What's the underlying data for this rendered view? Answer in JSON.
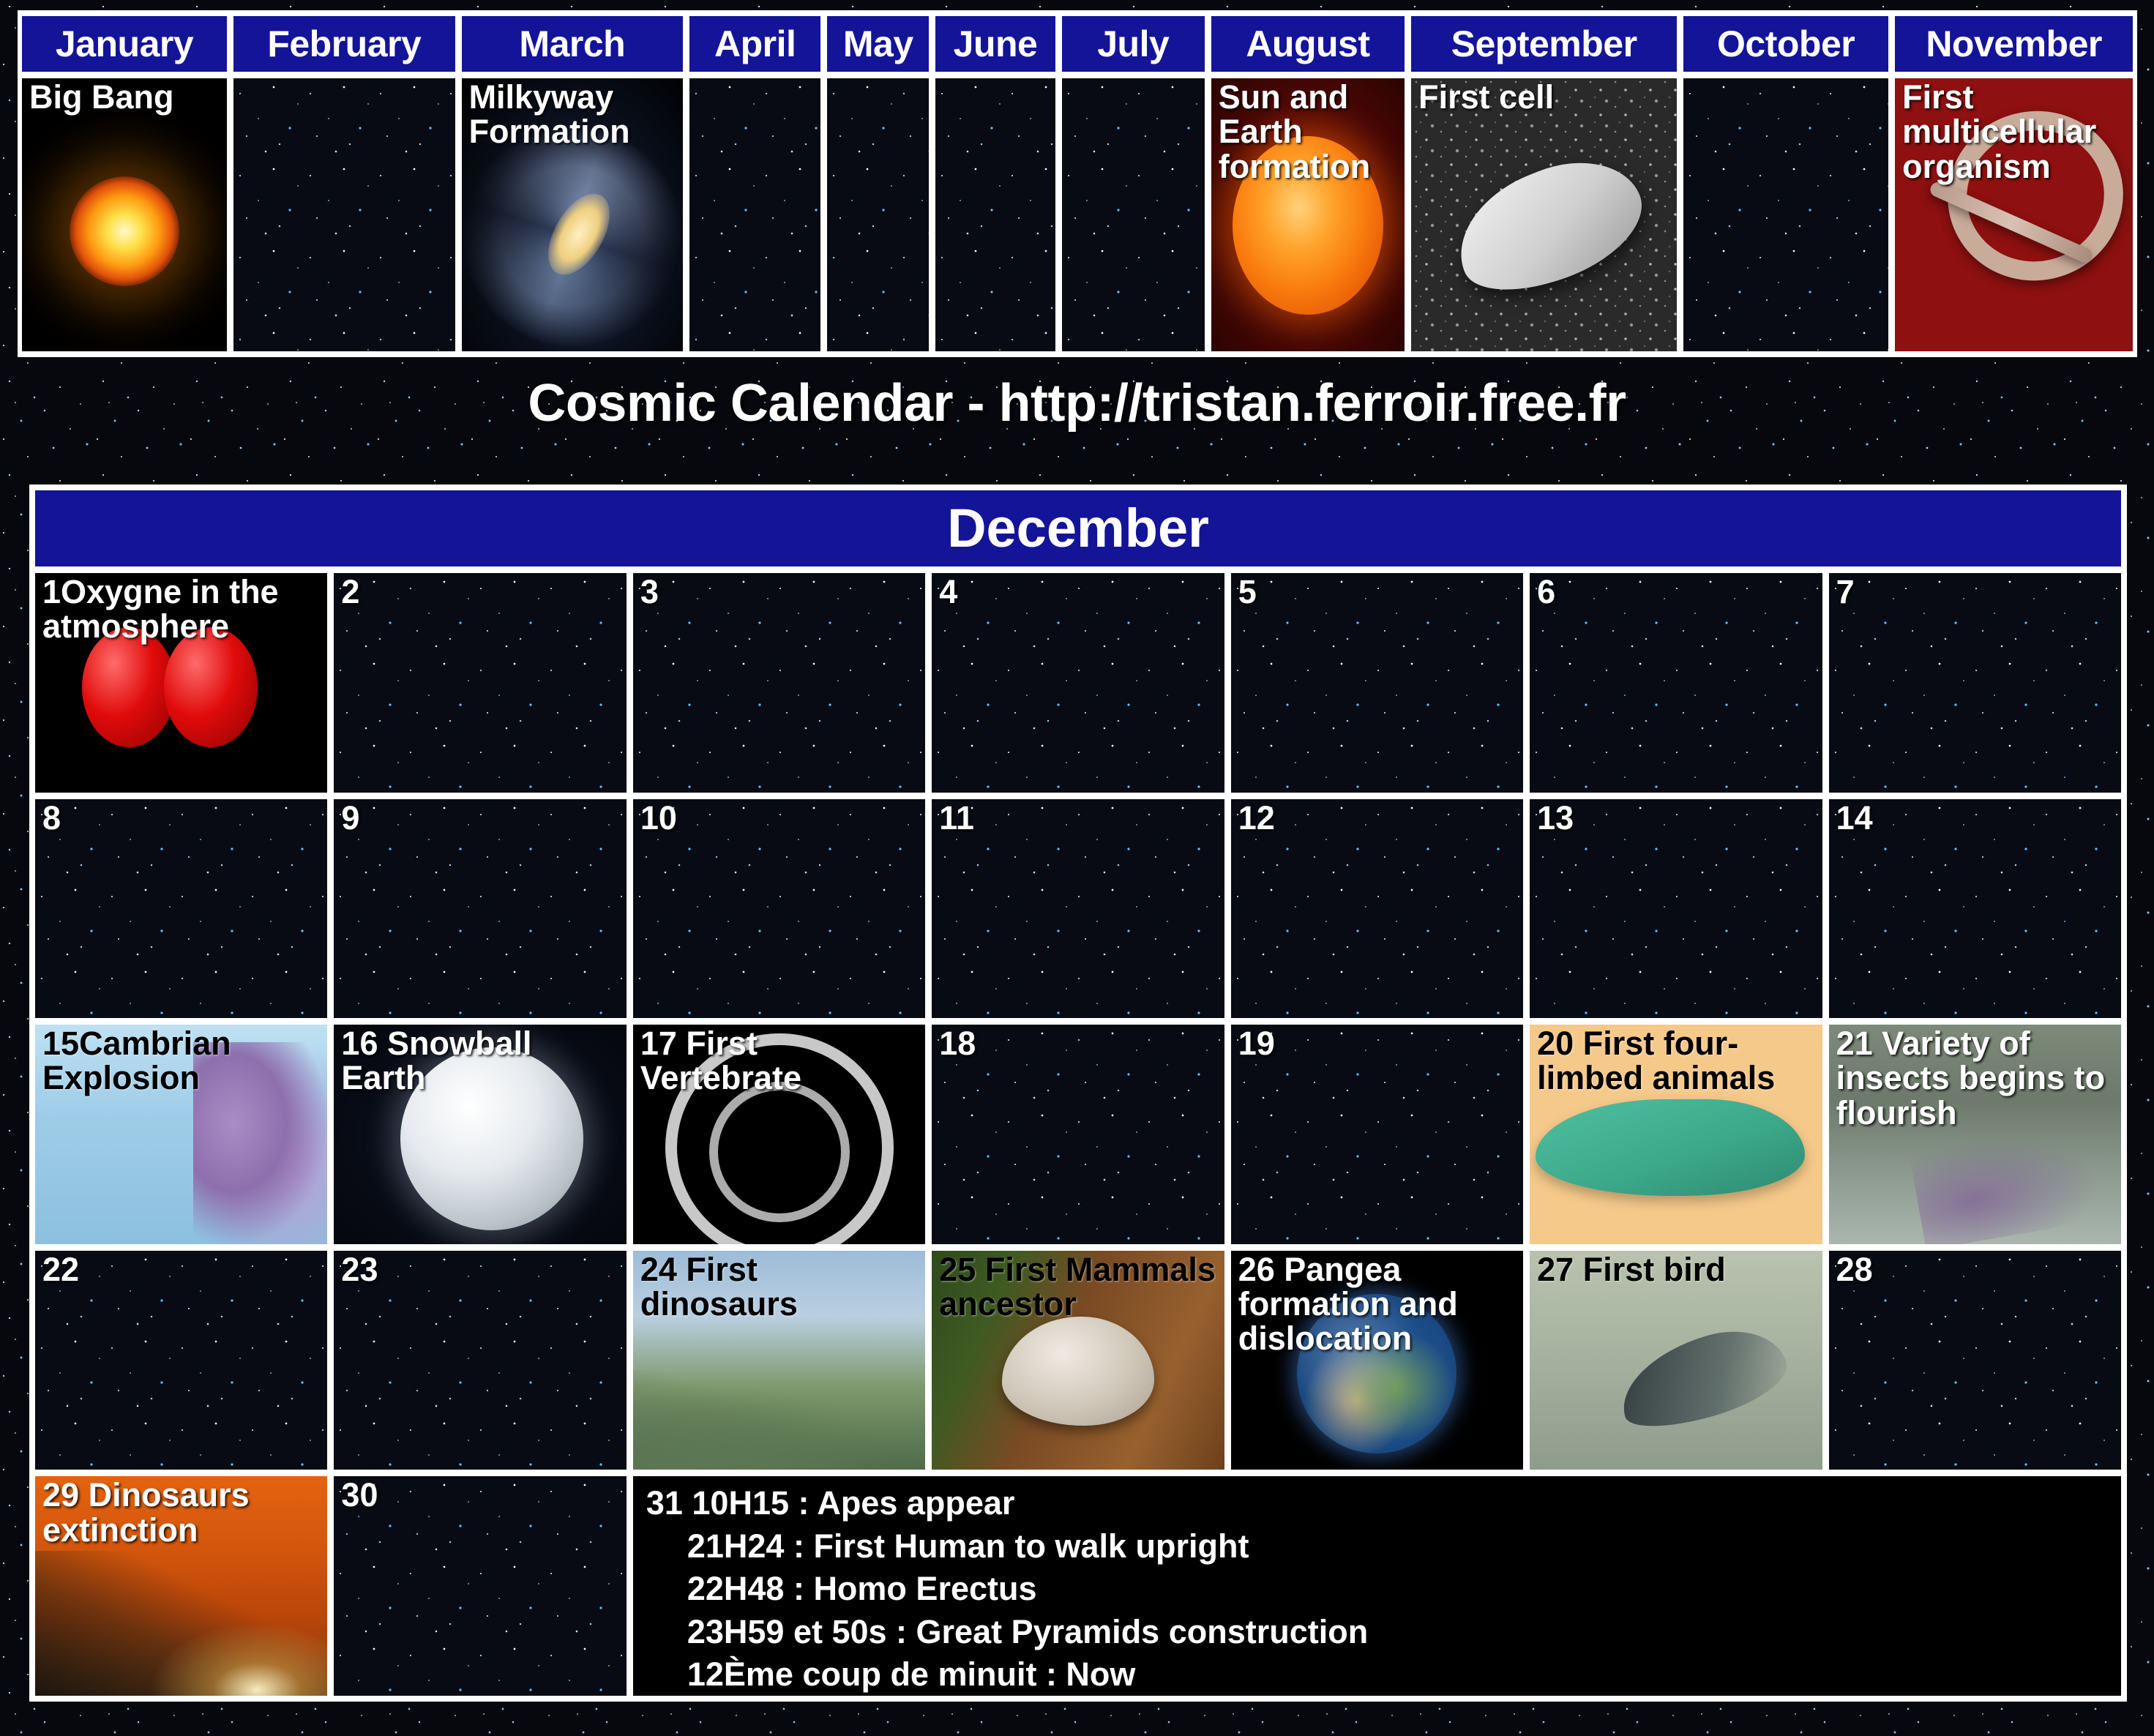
{
  "title": "Cosmic Calendar - http://tristan.ferroir.free.fr",
  "colors": {
    "header_blue": "#141499",
    "panel_white": "#ffffff",
    "caption_white": "#ffffff",
    "caption_black": "#000000"
  },
  "months": [
    {
      "name": "January",
      "caption": "Big Bang",
      "caption_color": "white",
      "art": "bigbang"
    },
    {
      "name": "February",
      "caption": "",
      "caption_color": "white",
      "art": "stars"
    },
    {
      "name": "March",
      "caption": "Milkyway Formation",
      "caption_color": "white",
      "art": "milkyway"
    },
    {
      "name": "April",
      "caption": "",
      "caption_color": "white",
      "art": "stars"
    },
    {
      "name": "May",
      "caption": "",
      "caption_color": "white",
      "art": "stars"
    },
    {
      "name": "June",
      "caption": "",
      "caption_color": "white",
      "art": "stars"
    },
    {
      "name": "July",
      "caption": "",
      "caption_color": "white",
      "art": "stars"
    },
    {
      "name": "August",
      "caption": "Sun and Earth formation",
      "caption_color": "white",
      "art": "sun"
    },
    {
      "name": "September",
      "caption": "First cell",
      "caption_color": "white",
      "art": "cell"
    },
    {
      "name": "October",
      "caption": "",
      "caption_color": "white",
      "art": "stars"
    },
    {
      "name": "November",
      "caption": "First multicellular organism",
      "caption_color": "white",
      "art": "worm"
    }
  ],
  "december": {
    "header": "December",
    "days": [
      {
        "num": "1",
        "caption": "Oxygne in the atmosphere",
        "caption_color": "white",
        "art": "o2"
      },
      {
        "num": "2",
        "caption": "",
        "caption_color": "white",
        "art": "stars"
      },
      {
        "num": "3",
        "caption": "",
        "caption_color": "white",
        "art": "stars"
      },
      {
        "num": "4",
        "caption": "",
        "caption_color": "white",
        "art": "stars"
      },
      {
        "num": "5",
        "caption": "",
        "caption_color": "white",
        "art": "stars"
      },
      {
        "num": "6",
        "caption": "",
        "caption_color": "white",
        "art": "stars"
      },
      {
        "num": "7",
        "caption": "",
        "caption_color": "white",
        "art": "stars"
      },
      {
        "num": "8",
        "caption": "",
        "caption_color": "white",
        "art": "stars"
      },
      {
        "num": "9",
        "caption": "",
        "caption_color": "white",
        "art": "stars"
      },
      {
        "num": "10",
        "caption": "",
        "caption_color": "white",
        "art": "stars"
      },
      {
        "num": "11",
        "caption": "",
        "caption_color": "white",
        "art": "stars"
      },
      {
        "num": "12",
        "caption": "",
        "caption_color": "white",
        "art": "stars"
      },
      {
        "num": "13",
        "caption": "",
        "caption_color": "white",
        "art": "stars"
      },
      {
        "num": "14",
        "caption": "",
        "caption_color": "white",
        "art": "stars"
      },
      {
        "num": "15",
        "caption": "Cambrian Explosion",
        "caption_color": "black",
        "art": "cambrian"
      },
      {
        "num": "16",
        "caption": " Snowball Earth",
        "caption_color": "white",
        "art": "snowball"
      },
      {
        "num": "17",
        "caption": "   First Vertebrate",
        "caption_color": "white",
        "art": "vertebrate"
      },
      {
        "num": "18",
        "caption": "",
        "caption_color": "white",
        "art": "stars"
      },
      {
        "num": "19",
        "caption": "",
        "caption_color": "white",
        "art": "stars"
      },
      {
        "num": "20",
        "caption": " First four-limbed animals",
        "caption_color": "black",
        "art": "tetrapod"
      },
      {
        "num": "21",
        "caption": " Variety of insects begins to flourish",
        "caption_color": "white",
        "art": "insects"
      },
      {
        "num": "22",
        "caption": "",
        "caption_color": "white",
        "art": "stars"
      },
      {
        "num": "23",
        "caption": "",
        "caption_color": "white",
        "art": "stars"
      },
      {
        "num": "24",
        "caption": " First dinosaurs",
        "caption_color": "black",
        "art": "dino"
      },
      {
        "num": "25",
        "caption": " First Mammals ancestor",
        "caption_color": "black",
        "art": "mammal"
      },
      {
        "num": "26",
        "caption": " Pangea formation and dislocation",
        "caption_color": "white",
        "art": "pangea"
      },
      {
        "num": "27",
        "caption": " First bird",
        "caption_color": "black",
        "art": "bird"
      },
      {
        "num": "28",
        "caption": "",
        "caption_color": "white",
        "art": "stars"
      },
      {
        "num": "29",
        "caption": " Dinosaurs extinction",
        "caption_color": "white",
        "art": "extinction"
      },
      {
        "num": "30",
        "caption": "",
        "caption_color": "white",
        "art": "stars"
      }
    ],
    "day31": {
      "num": "31",
      "lines": [
        "31 10H15 : Apes appear",
        "21H24 : First Human to walk upright",
        "22H48 : Homo Erectus",
        "23H59 et 50s : Great Pyramids construction",
        "12Ème coup de minuit : Now"
      ]
    }
  }
}
